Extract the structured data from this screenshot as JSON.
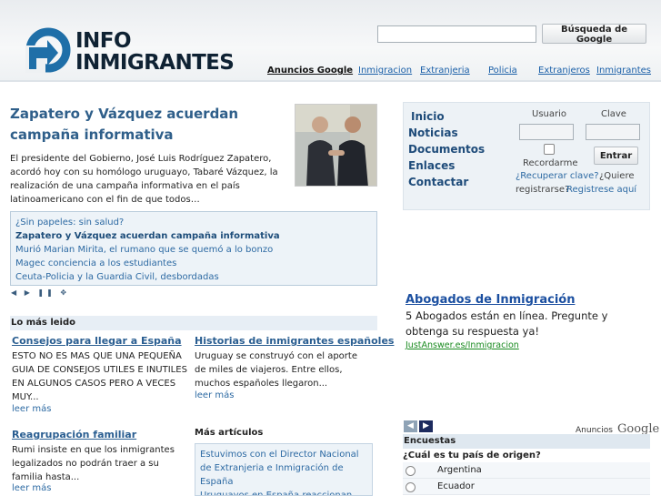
{
  "header": {
    "logo_line1": "INFO",
    "logo_line2": "INMIGRANTES",
    "search_button": "Búsqueda de Google",
    "ads_title": "Anuncios Google",
    "ad_links": [
      "Inmigracion",
      "Extranjeria",
      "Policia",
      "Extranjeros",
      "Inmigrantes"
    ]
  },
  "feature": {
    "title": "Zapatero y Vázquez acuerdan campaña informativa",
    "summary": "El presidente del Gobierno, José Luis Rodríguez Zapatero, acordó hoy con su homólogo uruguayo, Tabaré Vázquez, la realización de una campaña informativa en el país latinoamericano con el fin de que todos…",
    "list": [
      "¿Sin papeles: sin salud?",
      "Zapatero y Vázquez acuerdan campaña informativa",
      "Murió Marian Mirita, el rumano que se quemó a lo bonzo",
      "Magec conciencia a los estudiantes",
      "Ceuta-Policia y la Guardia Civil, desbordadas"
    ],
    "controls": "◀ ▶ ❚❚ ✥"
  },
  "most_read": {
    "heading": "Lo más leido",
    "read_more": "leer más",
    "articles": [
      {
        "title": "Consejos para llegar a España",
        "text": "ESTO NO ES MAS QUE UNA PEQUEÑA GUIA DE CONSEJOS UTILES E INUTILES EN ALGUNOS CASOS PERO A VECES MUY..."
      },
      {
        "title": "Historias de inmigrantes españoles",
        "text": "Uruguay se construyó con el aporte de miles de viajeros. Entre ellos, muchos españoles llegaron..."
      },
      {
        "title": "Reagrupación familiar",
        "text": "Rumi insiste en que los inmigrantes legalizados no podrán traer a su familia hasta..."
      }
    ]
  },
  "more_articles": {
    "heading": "Más artículos",
    "items": [
      "Estuvimos con el Director Nacional de Extranjeria e Inmigración de España",
      "Uruguayos en España reaccionan con cautela a posible pacto"
    ]
  },
  "nav": [
    "Inicio",
    "Noticias",
    "Documentos",
    "Enlaces",
    "Contactar"
  ],
  "login": {
    "user_label": "Usuario",
    "key_label": "Clave",
    "remember": "Recordarme",
    "enter": "Entrar",
    "recover": "¿Recuperar clave?",
    "want": "¿Quiere",
    "register_q": "registrarse?",
    "register_link": "Registrese aquí"
  },
  "ad": {
    "title": "Abogados de Inmigración",
    "body": "5 Abogados están en línea. Pregunte y obtenga su respuesta ya!",
    "url": "JustAnswer.es/Inmigracion"
  },
  "poll": {
    "ads_by": "Anuncios",
    "ads_google": "Google",
    "heading": "Encuestas",
    "question": "¿Cuál es tu país de origen?",
    "options": [
      "Argentina",
      "Ecuador"
    ]
  },
  "colors": {
    "header_logo_blue": "#1f6fa8",
    "link_blue": "#2d6aa3",
    "nav_blue": "#1f4c7a",
    "ad_url_green": "#198a1f"
  }
}
